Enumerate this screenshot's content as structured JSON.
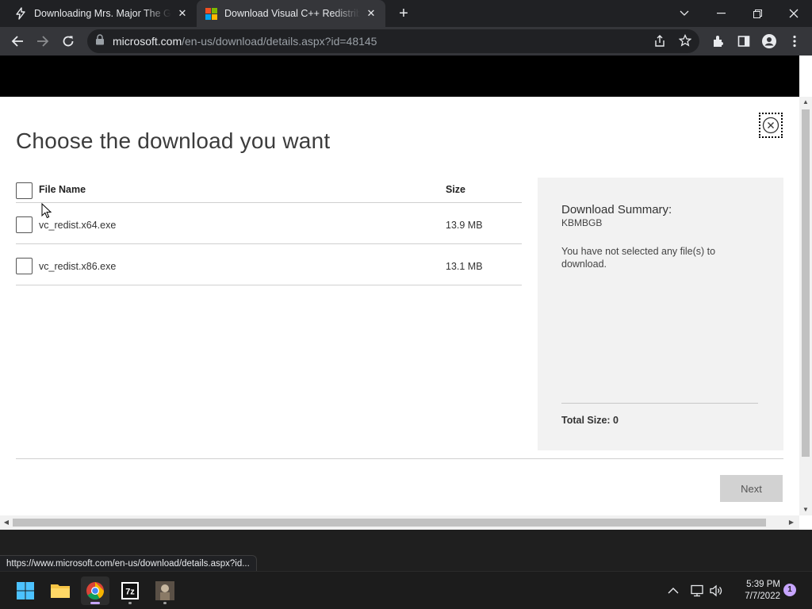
{
  "browser": {
    "tabs": [
      {
        "title": "Downloading Mrs. Major The Game",
        "active": false
      },
      {
        "title": "Download Visual C++ Redistributable",
        "active": true
      }
    ],
    "address": {
      "host": "microsoft.com",
      "path": "/en-us/download/details.aspx?id=48145"
    },
    "status_url": "https://www.microsoft.com/en-us/download/details.aspx?id..."
  },
  "dialog": {
    "title": "Choose the download you want",
    "table": {
      "headers": {
        "name": "File Name",
        "size": "Size"
      },
      "rows": [
        {
          "name": "vc_redist.x64.exe",
          "size": "13.9 MB",
          "checked": false
        },
        {
          "name": "vc_redist.x86.exe",
          "size": "13.1 MB",
          "checked": false
        }
      ]
    },
    "summary": {
      "title": "Download Summary:",
      "unit": "KBMBGB",
      "message": "You have not selected any file(s) to download.",
      "total": "Total Size: 0"
    },
    "next_label": "Next"
  },
  "taskbar": {
    "apps": [
      "windows-start",
      "file-explorer",
      "chrome",
      "7-zip",
      "game"
    ],
    "clock": {
      "time": "5:39 PM",
      "date": "7/7/2022"
    },
    "notifications": "1"
  },
  "colors": {
    "accent_tab": "#35363a",
    "page_bg": "#ffffff",
    "summary_bg": "#f2f2f2",
    "next_btn": "#d2d2d2",
    "notif": "#c7a5ff"
  }
}
